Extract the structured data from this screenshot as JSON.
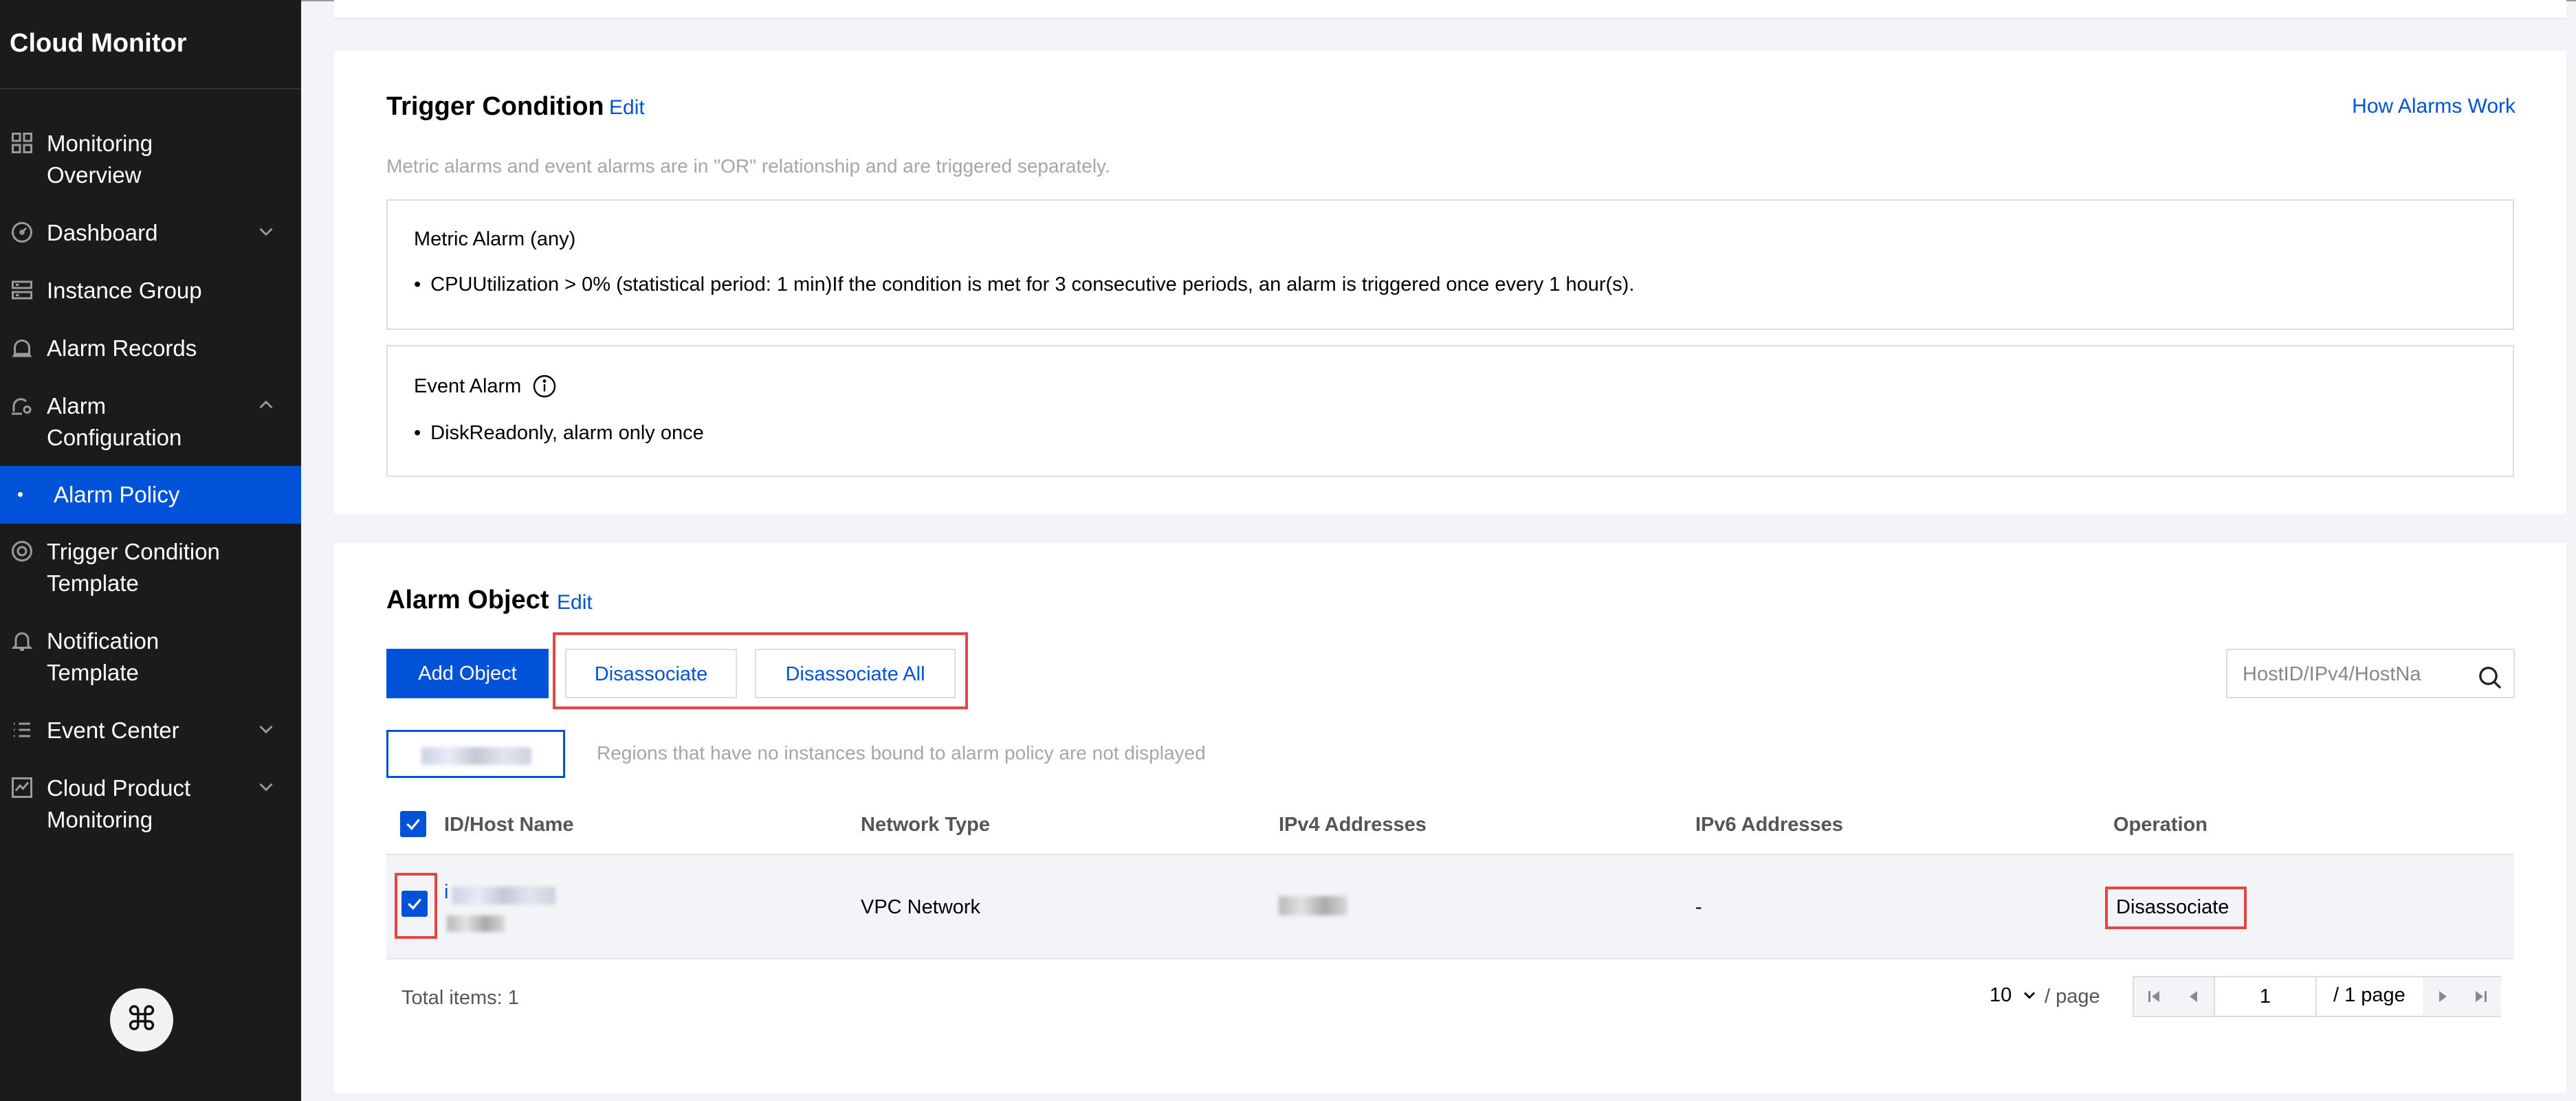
{
  "app": {
    "title": "Cloud Monitor"
  },
  "sidebar": {
    "items": [
      {
        "label": "Monitoring\nOverview",
        "icon": "grid-icon",
        "chevron": ""
      },
      {
        "label": "Dashboard",
        "icon": "gauge-icon",
        "chevron": "down"
      },
      {
        "label": "Instance Group",
        "icon": "server-stack-icon",
        "chevron": ""
      },
      {
        "label": "Alarm Records",
        "icon": "alarm-bell-icon",
        "chevron": ""
      },
      {
        "label": "Alarm\nConfiguration",
        "icon": "alarm-settings-icon",
        "chevron": "up"
      },
      {
        "label": "Alarm Policy",
        "icon": "dot-icon",
        "chevron": "",
        "active": true
      },
      {
        "label": "Trigger Condition\nTemplate",
        "icon": "target-icon",
        "chevron": ""
      },
      {
        "label": "Notification\nTemplate",
        "icon": "notification-bell-icon",
        "chevron": ""
      },
      {
        "label": "Event Center",
        "icon": "list-icon",
        "chevron": "down"
      },
      {
        "label": "Cloud Product\nMonitoring",
        "icon": "line-chart-icon",
        "chevron": "down"
      }
    ],
    "command_button": "⌘"
  },
  "trigger": {
    "title": "Trigger Condition",
    "edit_label": "Edit",
    "how_link": "How Alarms Work",
    "hint": "Metric alarms and event alarms are in \"OR\" relationship and are triggered separately.",
    "metric_heading": "Metric Alarm (any)",
    "metric_rule": "CPUUtilization > 0% (statistical period: 1 min)If the condition is met for 3 consecutive periods, an alarm is triggered once every 1 hour(s).",
    "event_heading": "Event Alarm",
    "event_rule": "DiskReadonly, alarm only once"
  },
  "alarm_object": {
    "title": "Alarm Object",
    "edit_label": "Edit",
    "add_button": "Add Object",
    "disassociate_button": "Disassociate",
    "disassociate_all_button": "Disassociate All",
    "search_placeholder": "HostID/IPv4/HostNa",
    "region_note": "Regions that have no instances bound to alarm policy are not displayed",
    "columns": [
      "ID/Host Name",
      "Network Type",
      "IPv4 Addresses",
      "IPv6 Addresses",
      "Operation"
    ],
    "rows": [
      {
        "id_prefix": "i",
        "network_type": "VPC Network",
        "ipv6": "-",
        "operation": "Disassociate"
      }
    ],
    "total": "Total items: 1",
    "page_size": "10",
    "per_page": "/ page",
    "current_page": "1",
    "page_total": "/ 1 page"
  },
  "colors": {
    "accent": "#0052d9",
    "sidebar_bg": "#1b1b1b",
    "highlight": "#e54545"
  }
}
